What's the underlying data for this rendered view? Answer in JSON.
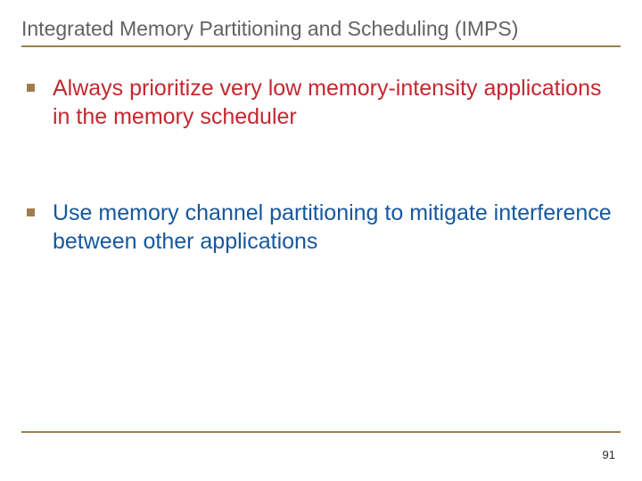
{
  "title": "Integrated Memory Partitioning and Scheduling (IMPS)",
  "bullets": [
    {
      "text": "Always prioritize very low memory-intensity applications in the memory scheduler",
      "color": "red"
    },
    {
      "text": "Use memory channel partitioning to mitigate interference between other applications",
      "color": "blue"
    }
  ],
  "pageNumber": "91"
}
